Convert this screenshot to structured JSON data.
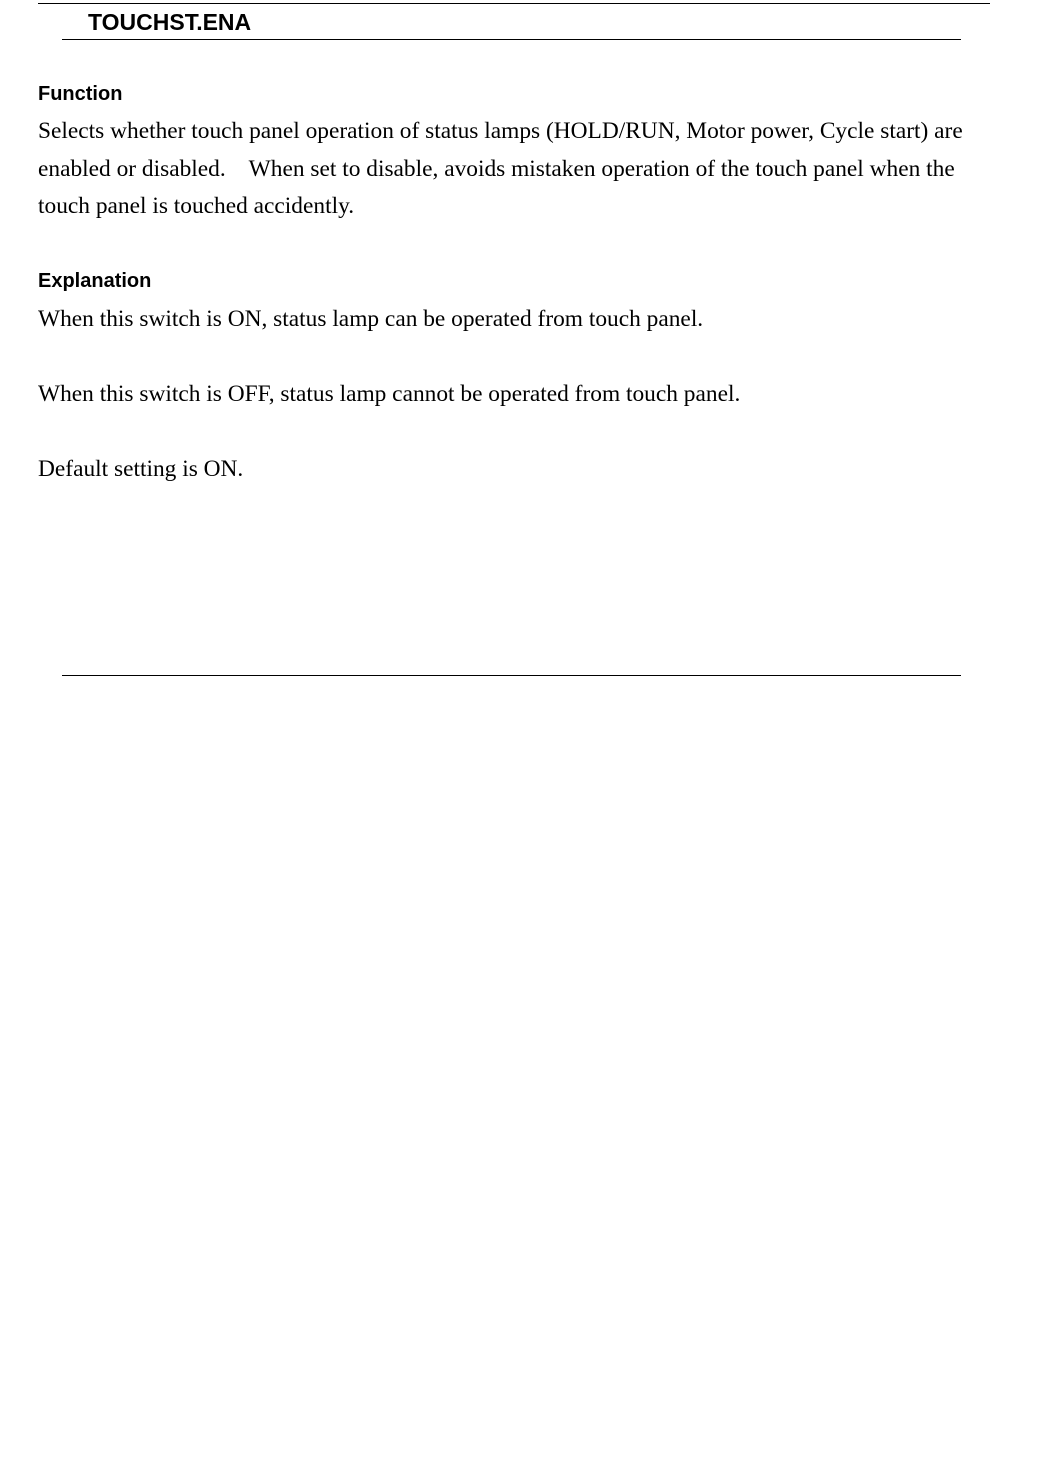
{
  "document": {
    "title": "TOUCHST.ENA",
    "sections": {
      "function": {
        "heading": "Function",
        "text": "Selects whether touch panel operation of status lamps (HOLD/RUN, Motor power, Cycle start) are enabled or disabled.    When set to disable, avoids mistaken operation of the touch panel when the touch panel is touched accidently."
      },
      "explanation": {
        "heading": "Explanation",
        "paragraphs": [
          "When this switch is ON, status lamp can be operated from touch panel.",
          "When this switch is OFF, status lamp cannot be operated from touch panel.",
          "Default setting is ON."
        ]
      }
    }
  }
}
